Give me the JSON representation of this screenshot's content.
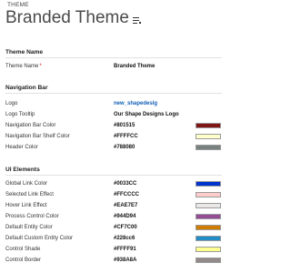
{
  "header": {
    "entity_label": "THEME",
    "title": "Branded Theme"
  },
  "sections": {
    "theme_name": {
      "title": "Theme Name",
      "name_label": "Theme Name",
      "name_value": "Branded Theme"
    },
    "navigation_bar": {
      "title": "Navigation Bar",
      "logo_label": "Logo",
      "logo_value": "new_shapedeslg",
      "logo_tooltip_label": "Logo Tooltip",
      "logo_tooltip_value": "Our Shape Designs Logo",
      "nav_color_label": "Navigation Bar Color",
      "nav_color_value": "#801515",
      "nav_shelf_label": "Navigation Bar Shelf Color",
      "nav_shelf_value": "#FFFFCC",
      "header_color_label": "Header Color",
      "header_color_value": "#788080"
    },
    "ui_elements": {
      "title": "UI Elements",
      "global_link_label": "Global Link Color",
      "global_link_value": "#0033CC",
      "selected_link_label": "Selected Link Effect",
      "selected_link_value": "#FFCCCC",
      "hover_link_label": "Hover Link Effect",
      "hover_link_value": "#EAE7E7",
      "process_control_label": "Process Control Color",
      "process_control_value": "#944D94",
      "default_entity_label": "Default Entity Color",
      "default_entity_value": "#CF7C00",
      "default_custom_label": "Default Custom Entity Color",
      "default_custom_value": "#228cc6",
      "control_shade_label": "Control Shade",
      "control_shade_value": "#FFFF91",
      "control_border_label": "Control Border",
      "control_border_value": "#938A8A"
    }
  },
  "swatch_colors": {
    "nav_color": "#801515",
    "nav_shelf": "#FFFFCC",
    "header_color": "#788080",
    "global_link": "#0033CC",
    "selected_link": "#FFCCCC",
    "hover_link": "#EAE7E7",
    "process_control": "#944D94",
    "default_entity": "#CF7C00",
    "default_custom": "#228cc6",
    "control_shade": "#FFFF91",
    "control_border": "#938A8A"
  },
  "accent_colors": {
    "required_marker": "#d00000",
    "link_text": "#1160b7"
  }
}
